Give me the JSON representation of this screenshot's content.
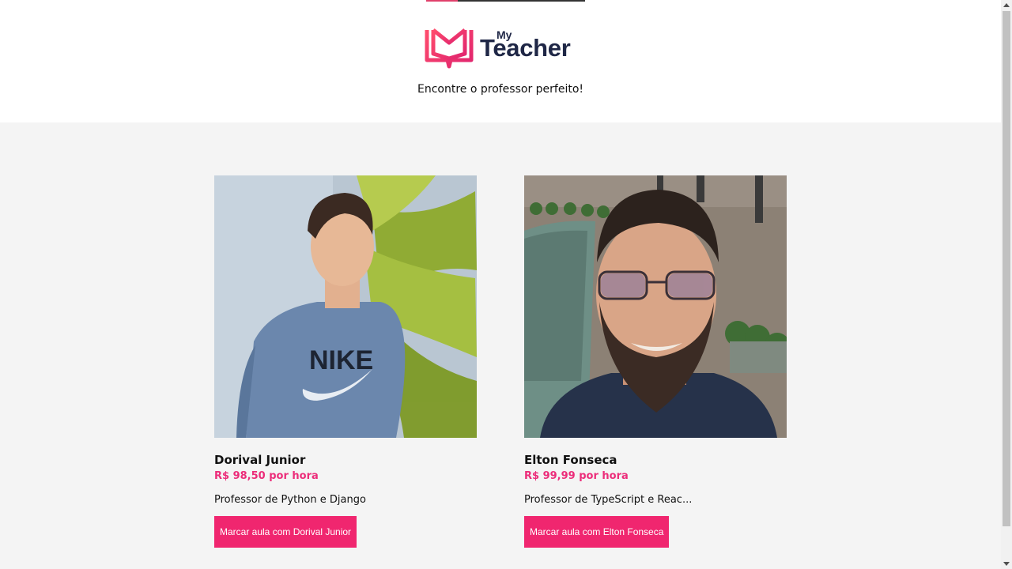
{
  "header": {
    "logo_my": "My",
    "logo_teacher": "Teacher",
    "tagline": "Encontre o professor perfeito!"
  },
  "page_progress": 0.2,
  "teachers": [
    {
      "name": "Dorival Junior",
      "price": "R$ 98,50 por hora",
      "description": "Professor de Python e Django",
      "button_label": "Marcar aula com Dorival Junior"
    },
    {
      "name": "Elton Fonseca",
      "price": "R$ 99,99 por hora",
      "description": "Professor de TypeScript e Reac...",
      "button_label": "Marcar aula com Elton Fonseca"
    }
  ],
  "colors": {
    "brand_pink": "#f0266f",
    "price_pink": "#ec2d7a",
    "logo_navy": "#1f2746",
    "background": "#f4f4f4"
  },
  "icons": {
    "logo": "open-book-logo-icon",
    "scroll_up": "scroll-up-arrow-icon",
    "scroll_down": "scroll-down-arrow-icon"
  }
}
